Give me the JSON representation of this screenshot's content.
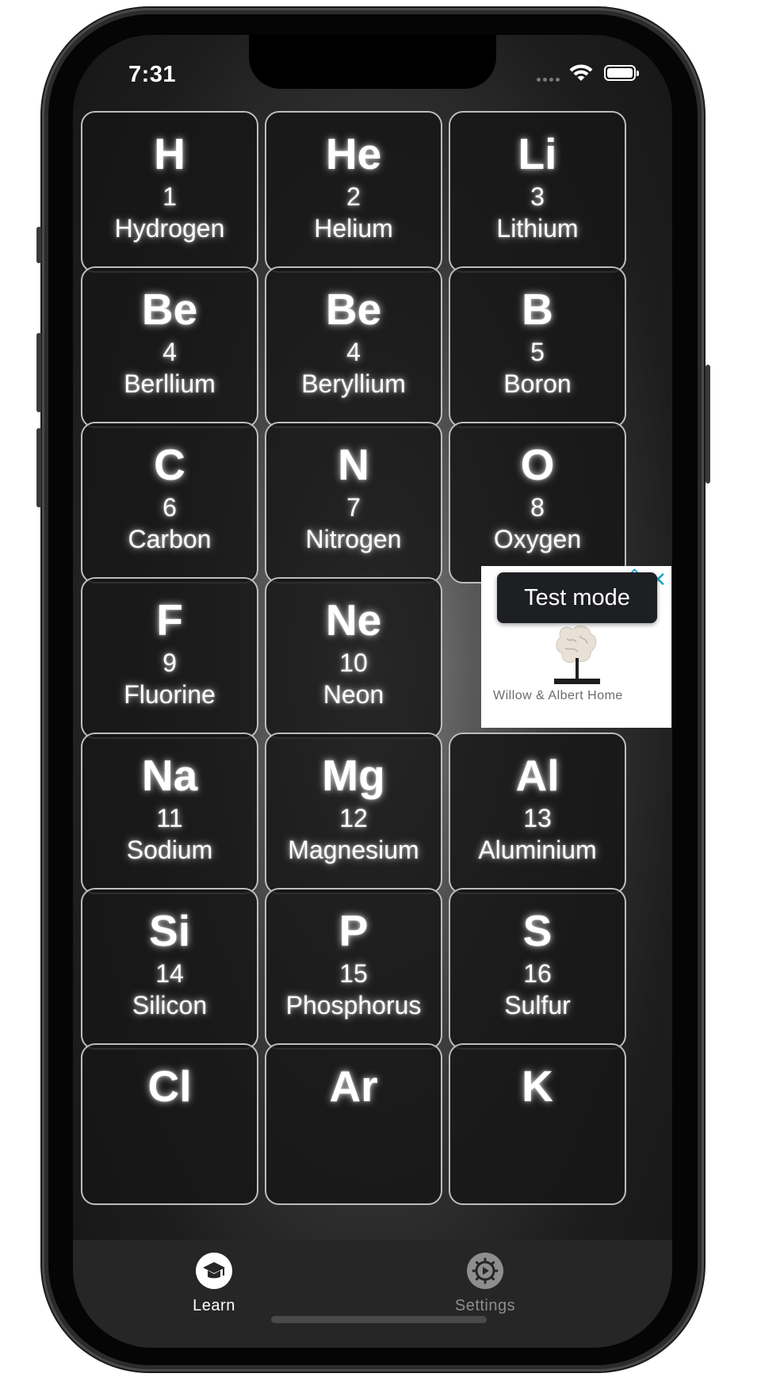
{
  "status_bar": {
    "time": "7:31"
  },
  "elements": [
    {
      "symbol": "H",
      "number": "1",
      "name": "Hydrogen"
    },
    {
      "symbol": "He",
      "number": "2",
      "name": "Helium"
    },
    {
      "symbol": "Li",
      "number": "3",
      "name": "Lithium"
    },
    {
      "symbol": "Be",
      "number": "4",
      "name": "Berllium"
    },
    {
      "symbol": "Be",
      "number": "4",
      "name": "Beryllium"
    },
    {
      "symbol": "B",
      "number": "5",
      "name": "Boron"
    },
    {
      "symbol": "C",
      "number": "6",
      "name": "Carbon"
    },
    {
      "symbol": "N",
      "number": "7",
      "name": "Nitrogen"
    },
    {
      "symbol": "O",
      "number": "8",
      "name": "Oxygen"
    },
    {
      "symbol": "F",
      "number": "9",
      "name": "Fluorine"
    },
    {
      "symbol": "Ne",
      "number": "10",
      "name": "Neon"
    },
    null,
    {
      "symbol": "Na",
      "number": "11",
      "name": "Sodium"
    },
    {
      "symbol": "Mg",
      "number": "12",
      "name": "Magnesium"
    },
    {
      "symbol": "Al",
      "number": "13",
      "name": "Aluminium"
    },
    {
      "symbol": "Si",
      "number": "14",
      "name": "Silicon"
    },
    {
      "symbol": "P",
      "number": "15",
      "name": "Phosphorus"
    },
    {
      "symbol": "S",
      "number": "16",
      "name": "Sulfur"
    },
    {
      "symbol": "Cl",
      "number": "",
      "name": ""
    },
    {
      "symbol": "Ar",
      "number": "",
      "name": ""
    },
    {
      "symbol": "K",
      "number": "",
      "name": ""
    }
  ],
  "ad": {
    "badge": "Test mode",
    "advertiser": "Willow & Albert Home",
    "close_icon": "close-icon",
    "choices_icon": "ad-choices-icon"
  },
  "tabs": [
    {
      "label": "Learn",
      "icon": "graduation-cap-icon",
      "selected": true,
      "color": "#ffffff"
    },
    {
      "label": "Settings",
      "icon": "gear-icon",
      "selected": false,
      "color": "#8e8e8e"
    }
  ]
}
